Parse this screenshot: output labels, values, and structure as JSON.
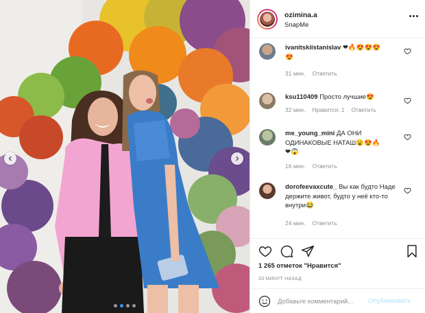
{
  "post": {
    "author": "ozimina.a",
    "location": "SnapMe"
  },
  "comments": [
    {
      "user": "ivanitskiistanislav",
      "text": "❤🔥😍😍😍\n😍",
      "time": "31 мин.",
      "actions": [
        "Ответить"
      ]
    },
    {
      "user": "ksu110409",
      "text": "Просто лучшие😍",
      "time": "32 мин.",
      "actions": [
        "Нравится: 1",
        "Ответить"
      ]
    },
    {
      "user": "me_young_mini",
      "text": "ДА ОНИ ОДИНАКОВЫЕ НАТАШ😮😍🔥\n❤😱",
      "time": "16 мин.",
      "actions": [
        "Ответить"
      ]
    },
    {
      "user": "dorofeevaxcute_",
      "text": "Вы как будто Наде держите живот, будто у неё кто-то внутри😂",
      "time": "24 мин.",
      "actions": [
        "Ответить"
      ]
    }
  ],
  "stats": {
    "likes": "1 265 отметок \"Нравится\"",
    "ago": "33 МИНУТ НАЗАД"
  },
  "add_comment": {
    "placeholder": "Добавьте комментарий...",
    "publish_label": "Опубликовать"
  },
  "icons": {
    "like": "heart-icon",
    "comment": "comment-icon",
    "share": "paper-plane-icon",
    "save": "bookmark-icon",
    "emoji": "smiley-icon",
    "more": "more-dots-icon"
  },
  "colors": {
    "accent": "#3897f0",
    "publish_disabled": "#b2dffc",
    "muted_text": "#8e8e8e"
  }
}
